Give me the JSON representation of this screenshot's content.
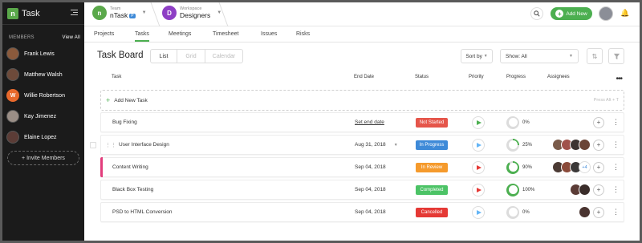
{
  "app": {
    "name": "Task",
    "logo_letter": "n"
  },
  "sidebar": {
    "members_label": "MEMBERS",
    "view_all": "View All",
    "members": [
      {
        "name": "Frank Lewis",
        "color": "#8a5a3c"
      },
      {
        "name": "Matthew Walsh",
        "color": "#6d4a3a"
      },
      {
        "name": "Willie Robertson",
        "color": "#e8692c",
        "initial": "W"
      },
      {
        "name": "Kay Jimenez",
        "color": "#9a8e86"
      },
      {
        "name": "Elaine Lopez",
        "color": "#5b3c36"
      }
    ],
    "invite_label": "+ Invite Members"
  },
  "topbar": {
    "team": {
      "label": "Team",
      "name": "nTask",
      "badge": "P",
      "color": "#5aa84a",
      "icon": "n"
    },
    "workspace": {
      "label": "Workspace",
      "name": "Designers",
      "letter": "D",
      "color": "#8e3fc5"
    },
    "add_new": "Add New"
  },
  "tabs": [
    "Projects",
    "Tasks",
    "Meetings",
    "Timesheet",
    "Issues",
    "Risks"
  ],
  "active_tab": "Tasks",
  "board": {
    "title": "Task Board",
    "views": [
      "List",
      "Grid",
      "Calendar"
    ],
    "sort_label": "Sort by",
    "show_label": "Show: All"
  },
  "table": {
    "headers": {
      "task": "Task",
      "end_date": "End Date",
      "status": "Status",
      "priority": "Priority",
      "progress": "Progress",
      "assignees": "Assignees"
    },
    "add_task": "Add New Task",
    "add_hint": "Press Alt + T",
    "rows": [
      {
        "task": "Bug Fixing",
        "end_date": "Set end date",
        "status": "Not Started",
        "status_color": "#e5554a",
        "priority_color": "#4caf50",
        "progress": 0,
        "progress_label": "0%",
        "assignees": []
      },
      {
        "task": "User Interface Design",
        "end_date": "Aug 31, 2018",
        "status": "In Progress",
        "status_color": "#3e8ad8",
        "priority_color": "#64b5f6",
        "progress": 25,
        "progress_label": "25%",
        "assignees": [
          "#7a5b4a",
          "#a0524a",
          "#3d3331",
          "#6b4436"
        ]
      },
      {
        "task": "Content Writing",
        "end_date": "Sep 04, 2018",
        "status": "In Review",
        "status_color": "#f59a2c",
        "priority_color": "#e53935",
        "progress": 90,
        "progress_label": "90%",
        "assignees": [
          "#4b3a34",
          "#8a4a3a",
          "#3b3838"
        ],
        "more": "+4"
      },
      {
        "task": "Black Box Testing",
        "end_date": "Sep 04, 2018",
        "status": "Completed",
        "status_color": "#4cc366",
        "priority_color": "#e53935",
        "progress": 100,
        "progress_label": "100%",
        "assignees": [
          "#5b3c36",
          "#3a2d2a"
        ]
      },
      {
        "task": "PSD to HTML Conversion",
        "end_date": "Sep 04, 2018",
        "status": "Cancelled",
        "status_color": "#e53935",
        "priority_color": "#64b5f6",
        "progress": 0,
        "progress_label": "0%",
        "assignees": [
          "#4a3430"
        ]
      }
    ]
  }
}
